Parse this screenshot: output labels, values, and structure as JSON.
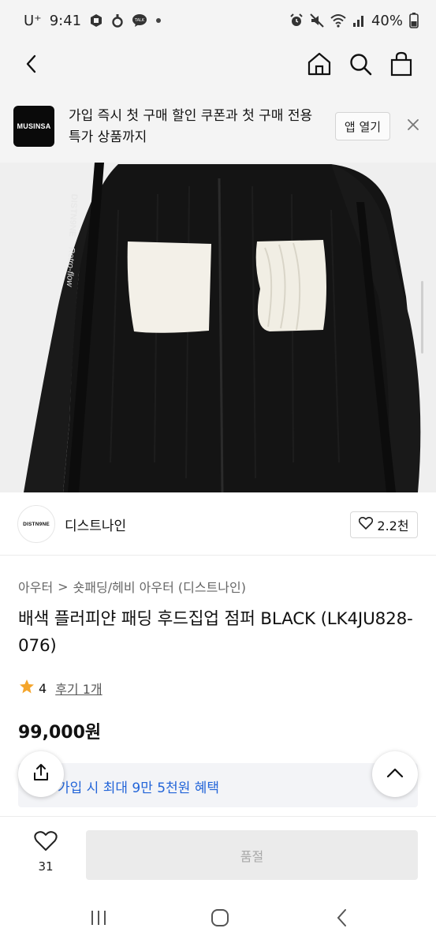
{
  "status_bar": {
    "carrier": "U⁺",
    "time": "9:41",
    "battery": "40%",
    "left_icons": [
      "app-icon",
      "s-icon",
      "talk-icon",
      "dot-icon"
    ],
    "right_icons": [
      "alarm-icon",
      "mute-icon",
      "wifi-icon",
      "signal-icon",
      "battery-icon"
    ]
  },
  "top_nav": {
    "icons": [
      "back-arrow-icon",
      "home-icon",
      "search-icon",
      "shopping-bag-icon"
    ]
  },
  "banner": {
    "logo_text": "MUSINSA",
    "text": "가입 즉시 첫 구매 할인 쿠폰과 첫 구매 전용 특가 상품까지",
    "open_button": "앱 열기"
  },
  "product_image": {
    "print_text": [
      "DISTN9NE",
      "Retro-flow"
    ]
  },
  "brand": {
    "logo_text": "DISTN9NE",
    "name": "디스트나인",
    "likes": "2.2천"
  },
  "breadcrumb": {
    "level1": "아우터",
    "separator": ">",
    "level2": "숏패딩/헤비 아우터 (디스트나인)"
  },
  "product": {
    "title": "배색 플러피얀 패딩 후드집업 점퍼 BLACK (LK4JU828-076)",
    "rating": "4",
    "review_link": "후기 1개",
    "price": "99,000원"
  },
  "benefit": {
    "text": "가입 시 최대 9만 5천원 혜택"
  },
  "bottom_bar": {
    "wish_count": "31",
    "buy_label": "품절"
  },
  "android_nav": {
    "icons": [
      "recent-apps-icon",
      "home-circle-icon",
      "back-chevron-icon"
    ]
  },
  "colors": {
    "accent_blue": "#2264d8",
    "star": "#f4a52b",
    "disabled_text": "#a9a9a9"
  }
}
